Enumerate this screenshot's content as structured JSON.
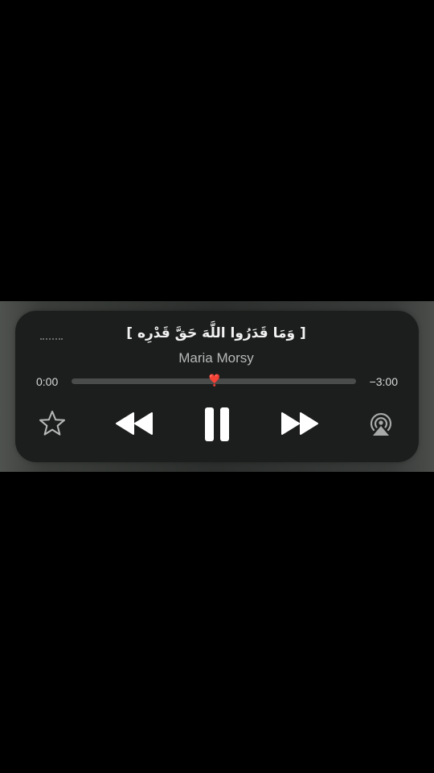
{
  "now_playing": {
    "title": "[ وَمَا قَدَرُوا اللَّهَ حَقَّ قَدْرِه ]",
    "artist": "Maria Morsy",
    "elapsed": "0:00",
    "remaining": "−3:00",
    "progress": 0.5,
    "scrubber_knob_glyph": "❣️"
  },
  "icons": {
    "grabber": "grabber-dots-icon",
    "favorite": "star-icon",
    "rewind": "rewind-icon",
    "pause": "pause-icon",
    "forward": "fast-forward-icon",
    "airplay": "airplay-icon"
  },
  "colors": {
    "card_background": "#1c1e1d",
    "text_primary": "#f2f2f2",
    "text_secondary": "#b7b9b8",
    "track": "#4a4c4b",
    "knob": "#e0243a"
  }
}
